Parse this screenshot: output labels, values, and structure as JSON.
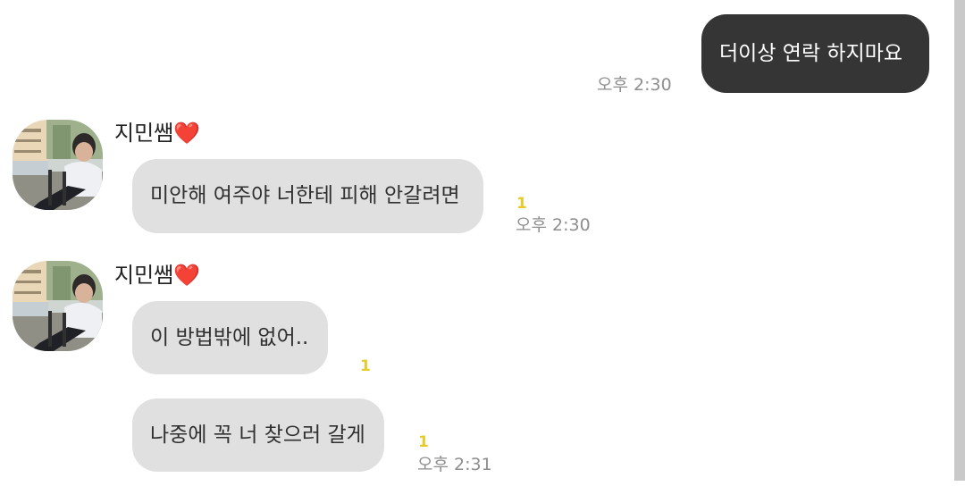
{
  "messages": [
    {
      "side": "me",
      "text": "더이상 연락 하지마요",
      "time": "오후 2:30"
    },
    {
      "side": "them",
      "sender": "지민쌤❤️",
      "text": "미안해 여주야 너한테 피해 안갈려면",
      "unread": "1",
      "time": "오후 2:30"
    },
    {
      "side": "them",
      "sender": "지민쌤❤️",
      "text": "이 방법밖에 없어..",
      "unread": "1"
    },
    {
      "side": "them",
      "text": "나중에 꼭 너 찾으러 갈게",
      "unread": "1",
      "time": "오후 2:31"
    }
  ],
  "colors": {
    "my_bubble": "#353535",
    "their_bubble": "#e0e0e0",
    "unread_badge": "#e6cb2b",
    "timestamp": "#8e8e8e"
  }
}
